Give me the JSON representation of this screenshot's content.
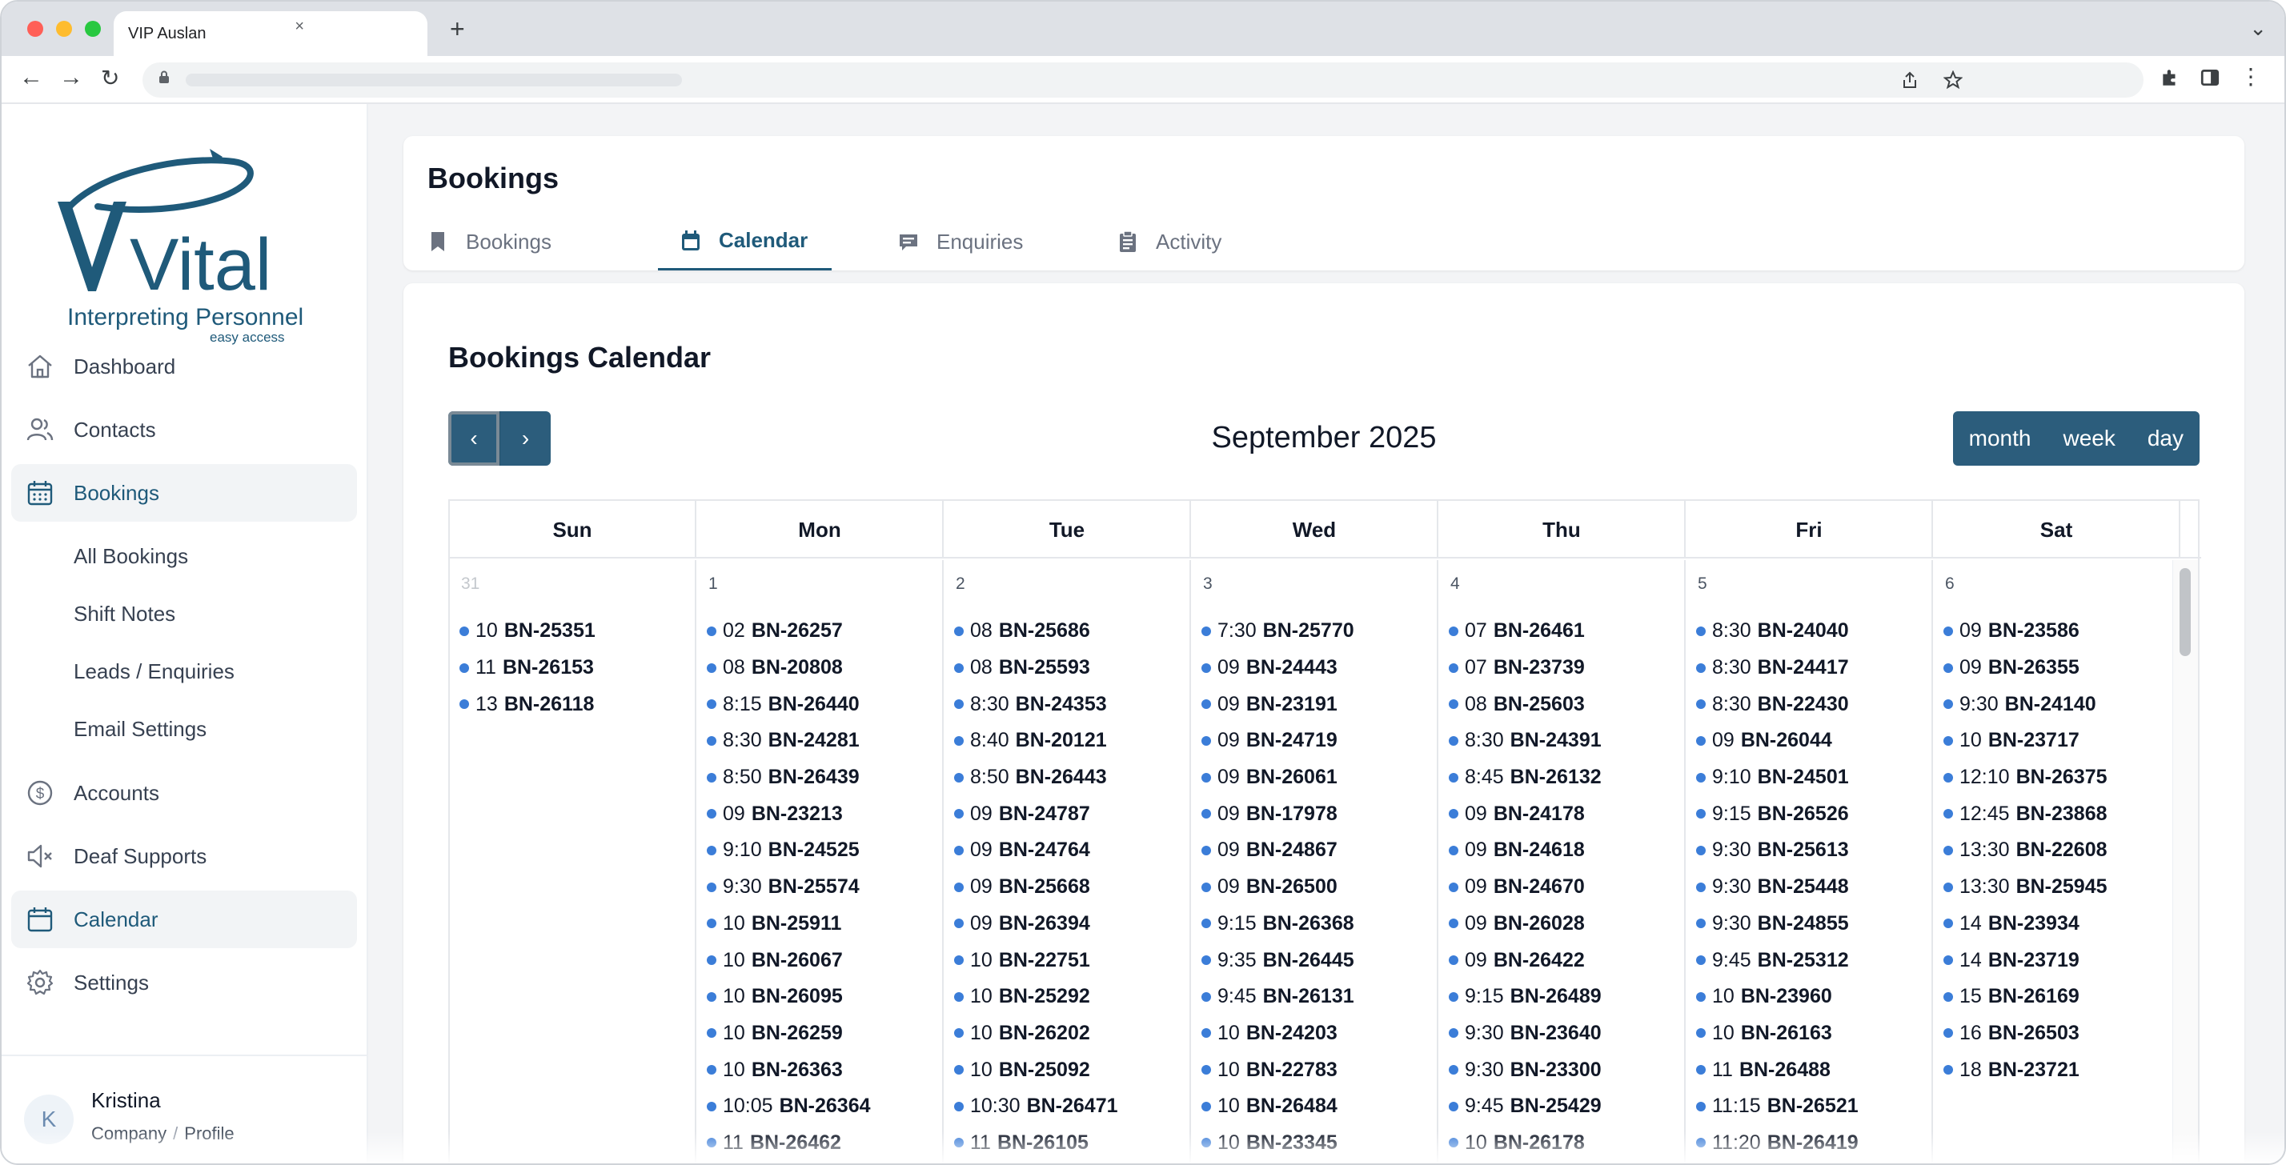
{
  "browser": {
    "tab_title": "VIP Auslan",
    "close_glyph": "×",
    "new_tab_glyph": "+"
  },
  "brand": {
    "logo_word": "Vital",
    "name": "Interpreting Personnel",
    "tagline": "easy access",
    "color": "#1f5a7a"
  },
  "sidebar": {
    "items": [
      {
        "label": "Dashboard",
        "icon": "home-icon"
      },
      {
        "label": "Contacts",
        "icon": "users-icon"
      },
      {
        "label": "Bookings",
        "icon": "calendar-grid-icon"
      },
      {
        "label": "Accounts",
        "icon": "dollar-circle-icon"
      },
      {
        "label": "Deaf Supports",
        "icon": "speaker-mute-icon"
      },
      {
        "label": "Calendar",
        "icon": "calendar-icon"
      },
      {
        "label": "Settings",
        "icon": "gear-icon"
      }
    ],
    "sub_items": [
      "All Bookings",
      "Shift Notes",
      "Leads / Enquiries",
      "Email Settings"
    ]
  },
  "user": {
    "initial": "K",
    "name": "Kristina",
    "company_link": "Company",
    "separator": "/",
    "profile_link": "Profile"
  },
  "header": {
    "title": "Bookings",
    "tabs": [
      {
        "label": "Bookings",
        "icon": "bookmark-icon"
      },
      {
        "label": "Calendar",
        "icon": "calendar-icon"
      },
      {
        "label": "Enquiries",
        "icon": "chat-icon"
      },
      {
        "label": "Activity",
        "icon": "clipboard-icon"
      }
    ],
    "active_tab": "Calendar"
  },
  "calendar": {
    "title": "Bookings Calendar",
    "month_title": "September 2025",
    "prev_glyph": "‹",
    "next_glyph": "›",
    "views": [
      "month",
      "week",
      "day"
    ],
    "weekdays": [
      "Sun",
      "Mon",
      "Tue",
      "Wed",
      "Thu",
      "Fri",
      "Sat"
    ],
    "event_color": "#3b7dd8",
    "accent": "#2c5d7c",
    "days": [
      {
        "num": "31",
        "other_month": true,
        "events": [
          [
            "10",
            "BN-25351"
          ],
          [
            "11",
            "BN-26153"
          ],
          [
            "13",
            "BN-26118"
          ]
        ]
      },
      {
        "num": "1",
        "other_month": false,
        "events": [
          [
            "02",
            "BN-26257"
          ],
          [
            "08",
            "BN-20808"
          ],
          [
            "8:15",
            "BN-26440"
          ],
          [
            "8:30",
            "BN-24281"
          ],
          [
            "8:50",
            "BN-26439"
          ],
          [
            "09",
            "BN-23213"
          ],
          [
            "9:10",
            "BN-24525"
          ],
          [
            "9:30",
            "BN-25574"
          ],
          [
            "10",
            "BN-25911"
          ],
          [
            "10",
            "BN-26067"
          ],
          [
            "10",
            "BN-26095"
          ],
          [
            "10",
            "BN-26259"
          ],
          [
            "10",
            "BN-26363"
          ],
          [
            "10:05",
            "BN-26364"
          ],
          [
            "11",
            "BN-26462"
          ]
        ]
      },
      {
        "num": "2",
        "other_month": false,
        "events": [
          [
            "08",
            "BN-25686"
          ],
          [
            "08",
            "BN-25593"
          ],
          [
            "8:30",
            "BN-24353"
          ],
          [
            "8:40",
            "BN-20121"
          ],
          [
            "8:50",
            "BN-26443"
          ],
          [
            "09",
            "BN-24787"
          ],
          [
            "09",
            "BN-24764"
          ],
          [
            "09",
            "BN-25668"
          ],
          [
            "09",
            "BN-26394"
          ],
          [
            "10",
            "BN-22751"
          ],
          [
            "10",
            "BN-25292"
          ],
          [
            "10",
            "BN-26202"
          ],
          [
            "10",
            "BN-25092"
          ],
          [
            "10:30",
            "BN-26471"
          ],
          [
            "11",
            "BN-26105"
          ]
        ]
      },
      {
        "num": "3",
        "other_month": false,
        "events": [
          [
            "7:30",
            "BN-25770"
          ],
          [
            "09",
            "BN-24443"
          ],
          [
            "09",
            "BN-23191"
          ],
          [
            "09",
            "BN-24719"
          ],
          [
            "09",
            "BN-26061"
          ],
          [
            "09",
            "BN-17978"
          ],
          [
            "09",
            "BN-24867"
          ],
          [
            "09",
            "BN-26500"
          ],
          [
            "9:15",
            "BN-26368"
          ],
          [
            "9:35",
            "BN-26445"
          ],
          [
            "9:45",
            "BN-26131"
          ],
          [
            "10",
            "BN-24203"
          ],
          [
            "10",
            "BN-22783"
          ],
          [
            "10",
            "BN-26484"
          ],
          [
            "10",
            "BN-23345"
          ]
        ]
      },
      {
        "num": "4",
        "other_month": false,
        "events": [
          [
            "07",
            "BN-26461"
          ],
          [
            "07",
            "BN-23739"
          ],
          [
            "08",
            "BN-25603"
          ],
          [
            "8:30",
            "BN-24391"
          ],
          [
            "8:45",
            "BN-26132"
          ],
          [
            "09",
            "BN-24178"
          ],
          [
            "09",
            "BN-24618"
          ],
          [
            "09",
            "BN-24670"
          ],
          [
            "09",
            "BN-26028"
          ],
          [
            "09",
            "BN-26422"
          ],
          [
            "9:15",
            "BN-26489"
          ],
          [
            "9:30",
            "BN-23640"
          ],
          [
            "9:30",
            "BN-23300"
          ],
          [
            "9:45",
            "BN-25429"
          ],
          [
            "10",
            "BN-26178"
          ]
        ]
      },
      {
        "num": "5",
        "other_month": false,
        "events": [
          [
            "8:30",
            "BN-24040"
          ],
          [
            "8:30",
            "BN-24417"
          ],
          [
            "8:30",
            "BN-22430"
          ],
          [
            "09",
            "BN-26044"
          ],
          [
            "9:10",
            "BN-24501"
          ],
          [
            "9:15",
            "BN-26526"
          ],
          [
            "9:30",
            "BN-25613"
          ],
          [
            "9:30",
            "BN-25448"
          ],
          [
            "9:30",
            "BN-24855"
          ],
          [
            "9:45",
            "BN-25312"
          ],
          [
            "10",
            "BN-23960"
          ],
          [
            "10",
            "BN-26163"
          ],
          [
            "11",
            "BN-26488"
          ],
          [
            "11:15",
            "BN-26521"
          ],
          [
            "11:20",
            "BN-26419"
          ]
        ]
      },
      {
        "num": "6",
        "other_month": false,
        "events": [
          [
            "09",
            "BN-23586"
          ],
          [
            "09",
            "BN-26355"
          ],
          [
            "9:30",
            "BN-24140"
          ],
          [
            "10",
            "BN-23717"
          ],
          [
            "12:10",
            "BN-26375"
          ],
          [
            "12:45",
            "BN-23868"
          ],
          [
            "13:30",
            "BN-22608"
          ],
          [
            "13:30",
            "BN-25945"
          ],
          [
            "14",
            "BN-23934"
          ],
          [
            "14",
            "BN-23719"
          ],
          [
            "15",
            "BN-26169"
          ],
          [
            "16",
            "BN-26503"
          ],
          [
            "18",
            "BN-23721"
          ]
        ]
      }
    ]
  }
}
